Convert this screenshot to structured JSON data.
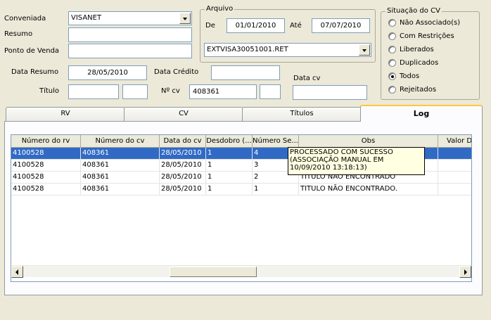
{
  "filters": {
    "conveniada_label": "Conveniada",
    "conveniada_value": "VISANET",
    "resumo_label": "Resumo",
    "resumo_value": "",
    "ponto_venda_label": "Ponto de Venda",
    "ponto_venda_value": "",
    "data_resumo_label": "Data Resumo",
    "data_resumo_value": "28/05/2010",
    "data_credito_label": "Data Crédito",
    "data_credito_value": "",
    "titulo_label": "Título",
    "titulo_value": "",
    "titulo_value2": "",
    "ncv_label": "Nº cv",
    "ncv_value": "408361",
    "ncv_value2": "",
    "data_cv_label": "Data cv",
    "data_cv_value": ""
  },
  "arquivo": {
    "group_label": "Arquivo",
    "de_label": "De",
    "de_value": "01/01/2010",
    "ate_label": "Até",
    "ate_value": "07/07/2010",
    "file_value": "EXTVISA30051001.RET"
  },
  "situacao": {
    "group_label": "Situação do CV",
    "options": [
      {
        "label": "Não Associado(s)",
        "checked": false
      },
      {
        "label": "Com Restrições",
        "checked": false
      },
      {
        "label": "Liberados",
        "checked": false
      },
      {
        "label": "Duplicados",
        "checked": false
      },
      {
        "label": "Todos",
        "checked": true
      },
      {
        "label": "Rejeitados",
        "checked": false
      }
    ]
  },
  "tabs": [
    {
      "label": "RV"
    },
    {
      "label": "CV"
    },
    {
      "label": "Títulos"
    },
    {
      "label": "Log",
      "active": true
    }
  ],
  "grid": {
    "columns": [
      "Número do rv",
      "Número do cv",
      "Data do cv",
      "Desdobro (...",
      "Número Se...",
      "Obs",
      "Valor Difere"
    ],
    "rows": [
      [
        "4100528",
        "408361",
        "28/05/2010",
        "1",
        "4",
        "",
        ""
      ],
      [
        "4100528",
        "408361",
        "28/05/2010",
        "1",
        "3",
        "",
        ""
      ],
      [
        "4100528",
        "408361",
        "28/05/2010",
        "1",
        "2",
        "TITULO NÃO ENCONTRADO",
        ""
      ],
      [
        "4100528",
        "408361",
        "28/05/2010",
        "1",
        "1",
        "TITULO NÃO ENCONTRADO.",
        ""
      ]
    ],
    "selected_row": 0,
    "tooltip_lines": [
      "PROCESSADO COM SUCESSO",
      "(ASSOCIAÇÃO MANUAL EM",
      "10/09/2010 13:18:13)"
    ]
  },
  "colors": {
    "selection": "#316ac5",
    "tooltip_bg": "#ffffe1",
    "active_tab_accent": "#ffc83c"
  }
}
